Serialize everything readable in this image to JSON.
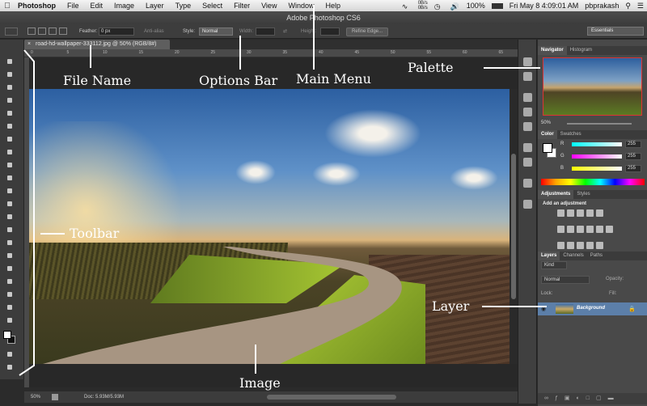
{
  "menubar": {
    "app_name": "Photoshop",
    "items": [
      "File",
      "Edit",
      "Image",
      "Layer",
      "Type",
      "Select",
      "Filter",
      "View",
      "Window",
      "Help"
    ],
    "battery": "100%",
    "datetime": "Fri May 8  4:09:01 AM",
    "user": "pbprakash",
    "net_up": "0B/s",
    "net_down": "0B/s"
  },
  "window": {
    "title": "Adobe Photoshop CS6"
  },
  "options_bar": {
    "feather_label": "Feather:",
    "feather_value": "0 px",
    "antialias_label": "Anti-alias",
    "style_label": "Style:",
    "style_value": "Normal",
    "width_label": "Width:",
    "height_label": "Height:",
    "refine_edge": "Refine Edge...",
    "workspace": "Essentials"
  },
  "document": {
    "tab_close": "×",
    "tab_title": "road-hd-wallpaper-333112.jpg @ 50% (RGB/8#)",
    "ruler_ticks": [
      "0",
      "5",
      "10",
      "15",
      "20",
      "25",
      "30",
      "35",
      "40",
      "45",
      "50",
      "55",
      "60",
      "65"
    ]
  },
  "statusbar": {
    "zoom": "50%",
    "doc": "Doc: 5.93M/5.93M"
  },
  "panels": {
    "navigator_tabs": [
      "Navigator",
      "Histogram"
    ],
    "navigator_zoom": "50%",
    "color_tabs": [
      "Color",
      "Swatches"
    ],
    "color_channels": [
      {
        "label": "R",
        "value": "255"
      },
      {
        "label": "G",
        "value": "255"
      },
      {
        "label": "B",
        "value": "255"
      }
    ],
    "adjustments_tabs": [
      "Adjustments",
      "Styles"
    ],
    "adjustments_title": "Add an adjustment",
    "layers_tabs": [
      "Layers",
      "Channels",
      "Paths"
    ],
    "kind_label": "Kind",
    "blend_mode": "Normal",
    "opacity_label": "Opacity:",
    "lock_label": "Lock:",
    "fill_label": "Fill:",
    "layer_name": "Background"
  },
  "annotations": {
    "file_name": "File Name",
    "options_bar": "Options Bar",
    "main_menu": "Main Menu",
    "palette": "Palette",
    "toolbar": "Toolbar",
    "layer": "Layer",
    "image": "Image"
  },
  "colors": {
    "accent_layer": "#5c7fa9",
    "panel_bg": "#494949",
    "annotation_text": "#ffffff"
  }
}
